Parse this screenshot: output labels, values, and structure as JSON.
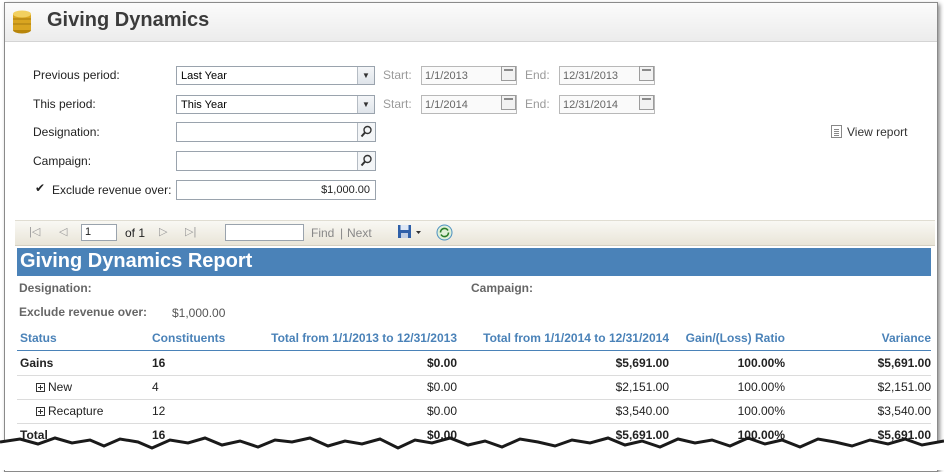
{
  "window": {
    "title": "Giving Dynamics"
  },
  "form": {
    "previous_period": {
      "label": "Previous period:",
      "value": "Last Year",
      "start_label": "Start:",
      "start": "1/1/2013",
      "end_label": "End:",
      "end": "12/31/2013"
    },
    "this_period": {
      "label": "This period:",
      "value": "This Year",
      "start_label": "Start:",
      "start": "1/1/2014",
      "end_label": "End:",
      "end": "12/31/2014"
    },
    "designation": {
      "label": "Designation:",
      "value": ""
    },
    "campaign": {
      "label": "Campaign:",
      "value": ""
    },
    "exclude": {
      "label": "Exclude revenue over:",
      "checked": true,
      "value": "$1,000.00"
    },
    "view_report": "View report"
  },
  "toolbar": {
    "page": "1",
    "of_label": "of 1",
    "find": "Find",
    "separator": "|",
    "next": "Next"
  },
  "report": {
    "title": "Giving Dynamics Report",
    "designation_label": "Designation:",
    "campaign_label": "Campaign:",
    "exclude_label": "Exclude revenue over:",
    "exclude_value": "$1,000.00",
    "columns": [
      "Status",
      "Constituents",
      "Total from 1/1/2013 to 12/31/2013",
      "Total from 1/1/2014 to 12/31/2014",
      "Gain/(Loss) Ratio",
      "Variance"
    ],
    "rows": [
      {
        "status": "Gains",
        "constituents": "16",
        "total_prev": "$0.00",
        "total_this": "$5,691.00",
        "ratio": "100.00%",
        "variance": "$5,691.00"
      },
      {
        "status": "New",
        "constituents": "4",
        "total_prev": "$0.00",
        "total_this": "$2,151.00",
        "ratio": "100.00%",
        "variance": "$2,151.00"
      },
      {
        "status": "Recapture",
        "constituents": "12",
        "total_prev": "$0.00",
        "total_this": "$3,540.00",
        "ratio": "100.00%",
        "variance": "$3,540.00"
      },
      {
        "status": "Total",
        "constituents": "16",
        "total_prev": "$0.00",
        "total_this": "$5,691.00",
        "ratio": "100.00%",
        "variance": "$5,691.00"
      }
    ]
  },
  "colors": {
    "report_header": "#4a82b8",
    "column_text": "#4a82b8"
  },
  "icons": [
    "coins-icon",
    "dropdown-arrow-icon",
    "calendar-icon",
    "search-icon",
    "checkbox-icon",
    "report-icon",
    "first-page-icon",
    "previous-page-icon",
    "next-page-icon",
    "last-page-icon",
    "save-icon",
    "refresh-icon"
  ]
}
